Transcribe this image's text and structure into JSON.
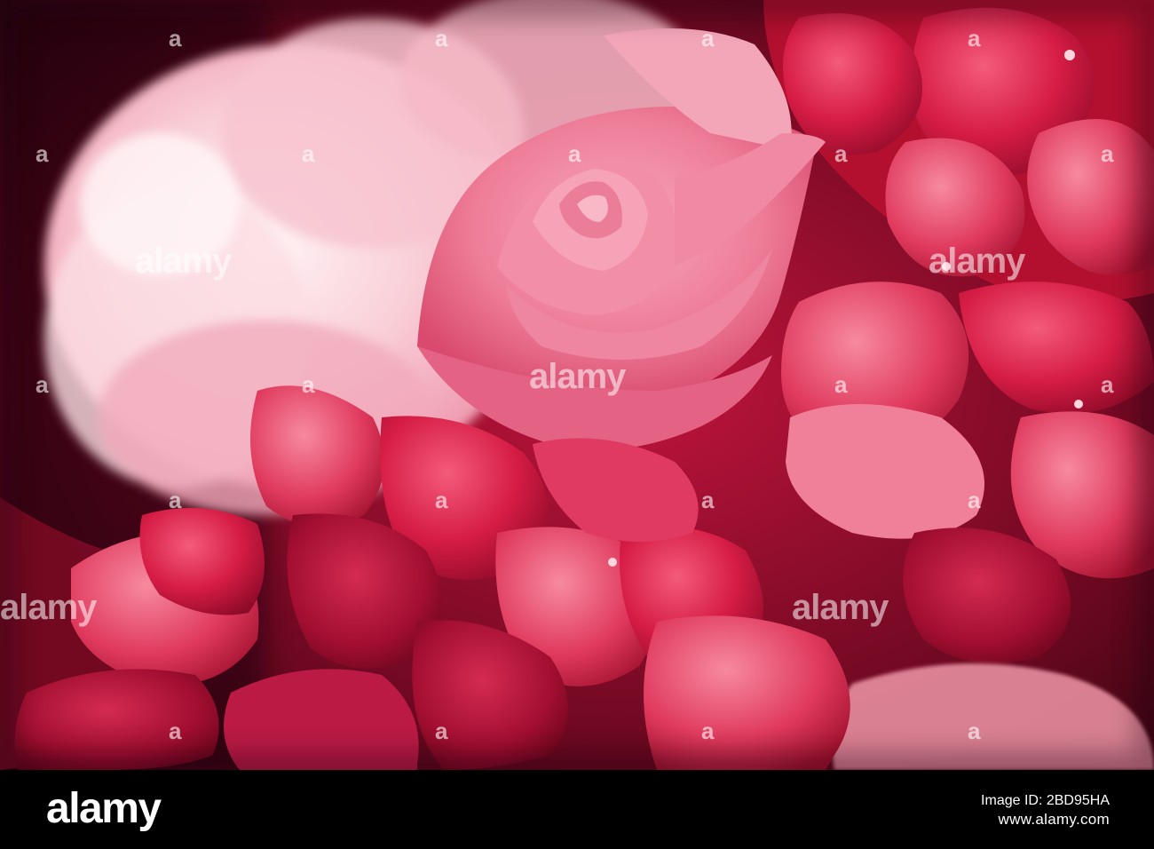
{
  "photo": {
    "subject": "pink rose and red hydrangea blossoms",
    "palette": {
      "background_dark": "#2a0610",
      "pale_peony": "#f6c6cf",
      "rose_pink": "#f07f9b",
      "rose_center": "#e86786",
      "hydrangea_red": "#d81d46",
      "hydrangea_deep": "#9c0c2c",
      "shadow": "#5e0418"
    }
  },
  "watermark": {
    "text": "alamy",
    "color": "rgba(255,255,255,0.55)"
  },
  "footer": {
    "logo": "alamy",
    "image_id_line": "Image ID: 2BD95HA",
    "site_line": "www.alamy.com"
  }
}
